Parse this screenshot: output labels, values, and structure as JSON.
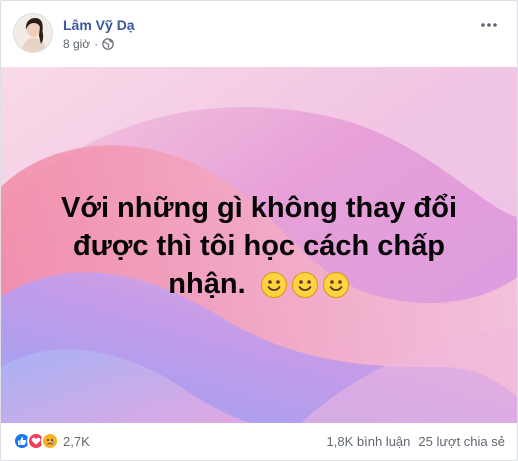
{
  "post": {
    "author": "Lâm Vỹ Dạ",
    "time": "8 giờ",
    "text_line1": "Với những gì không thay đổi",
    "text_line2": "được thì tôi học cách chấp",
    "text_line3": "nhận.",
    "privacy_icon": "globe-icon",
    "background_colors": [
      "#f2a7c4",
      "#e79ad3",
      "#b7a4ee",
      "#f6d5e8"
    ]
  },
  "footer": {
    "reactions": [
      "like-icon",
      "love-icon",
      "sad-icon"
    ],
    "reaction_count": "2,7K",
    "comments": "1,8K bình luận",
    "shares": "25 lượt chia sẻ"
  },
  "colors": {
    "name": "#385898",
    "meta": "#616770",
    "like": "#1877f2",
    "love": "#f33e58",
    "sad": "#f7b125"
  }
}
